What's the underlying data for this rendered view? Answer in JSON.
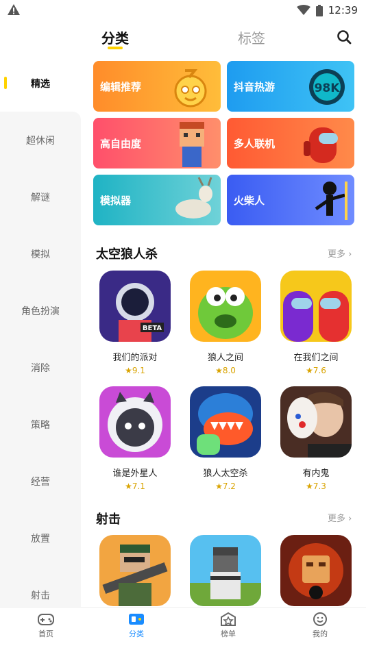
{
  "status": {
    "time": "12:39"
  },
  "tabs": {
    "category": "分类",
    "tags": "标签"
  },
  "sidebar": {
    "items": [
      {
        "label": "精选"
      },
      {
        "label": "超休闲"
      },
      {
        "label": "解谜"
      },
      {
        "label": "模拟"
      },
      {
        "label": "角色扮演"
      },
      {
        "label": "消除"
      },
      {
        "label": "策略"
      },
      {
        "label": "经营"
      },
      {
        "label": "放置"
      },
      {
        "label": "射击"
      }
    ]
  },
  "cards": [
    {
      "label": "编辑推荐",
      "color": "#ff9a2e"
    },
    {
      "label": "抖音热游",
      "color": "#23a8f2"
    },
    {
      "label": "高自由度",
      "color": "#ff5a6e"
    },
    {
      "label": "多人联机",
      "color": "#ff6b3d"
    },
    {
      "label": "模拟器",
      "color": "#22b8c8"
    },
    {
      "label": "火柴人",
      "color": "#4a6cf7"
    }
  ],
  "sections": {
    "werewolf": {
      "title": "太空狼人杀",
      "more": "更多",
      "games": [
        {
          "name": "我们的派对",
          "rating": "9.1"
        },
        {
          "name": "狼人之间",
          "rating": "8.0"
        },
        {
          "name": "在我们之间",
          "rating": "7.6"
        },
        {
          "name": "谁是外星人",
          "rating": "7.1"
        },
        {
          "name": "狼人太空杀",
          "rating": "7.2"
        },
        {
          "name": "有内鬼",
          "rating": "7.3"
        }
      ]
    },
    "shooting": {
      "title": "射击",
      "more": "更多"
    }
  },
  "card_art": {
    "score_badge": "98K"
  },
  "icon_text": {
    "beta": "BETA"
  },
  "nav": {
    "items": [
      {
        "label": "首页",
        "icon": "gamepad-icon"
      },
      {
        "label": "分类",
        "icon": "category-icon"
      },
      {
        "label": "榜单",
        "icon": "ranking-icon"
      },
      {
        "label": "我的",
        "icon": "profile-icon"
      }
    ]
  },
  "colors": {
    "accent": "#ffd200",
    "active_nav": "#1a8cff",
    "rating": "#d9a300"
  }
}
